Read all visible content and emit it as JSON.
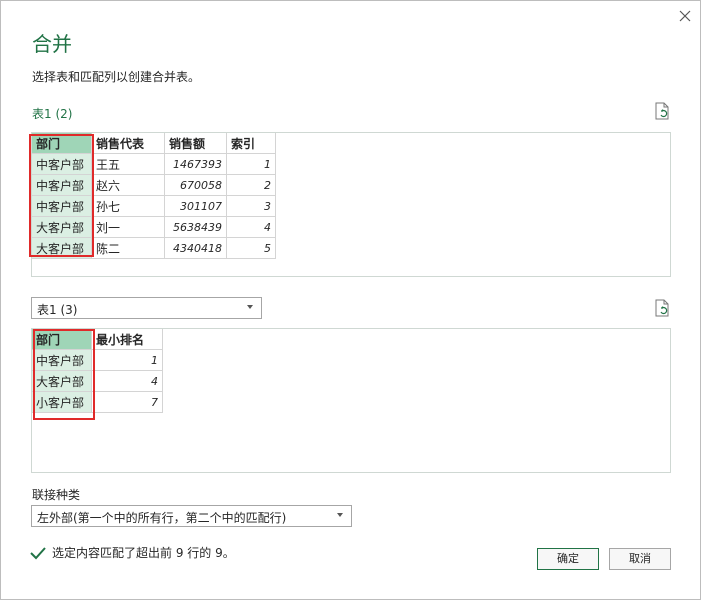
{
  "dialog": {
    "title": "合并",
    "subtitle": "选择表和匹配列以创建合并表。"
  },
  "table1": {
    "name": "表1 (2)",
    "columns": [
      "部门",
      "销售代表",
      "销售额",
      "索引"
    ],
    "rows": [
      [
        "中客户部",
        "王五",
        "1467393",
        "1"
      ],
      [
        "中客户部",
        "赵六",
        "670058",
        "2"
      ],
      [
        "中客户部",
        "孙七",
        "301107",
        "3"
      ],
      [
        "大客户部",
        "刘一",
        "5638439",
        "4"
      ],
      [
        "大客户部",
        "陈二",
        "4340418",
        "5"
      ]
    ]
  },
  "table2": {
    "selected": "表1 (3)",
    "columns": [
      "部门",
      "最小排名"
    ],
    "rows": [
      [
        "中客户部",
        "1"
      ],
      [
        "大客户部",
        "4"
      ],
      [
        "小客户部",
        "7"
      ]
    ]
  },
  "join": {
    "label": "联接种类",
    "selected": "左外部(第一个中的所有行，第二个中的匹配行)"
  },
  "status": {
    "text": "选定内容匹配了超出前 9 行的 9。"
  },
  "buttons": {
    "ok": "确定",
    "cancel": "取消"
  },
  "colors": {
    "accent": "#217346",
    "selected_header": "#9fd5b7",
    "selected_cell": "#dbefe3",
    "highlight_box": "#e02a2a"
  }
}
